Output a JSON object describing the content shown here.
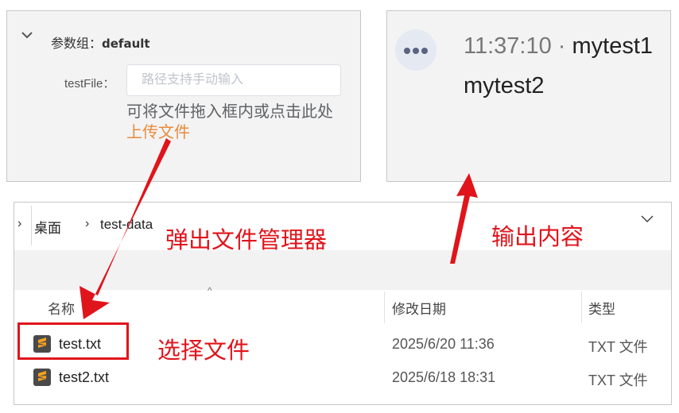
{
  "param_panel": {
    "group_label": "参数组：",
    "group_value": "default",
    "field_label": "testFile：",
    "input_placeholder": "路径支持手动输入",
    "hint_text": "可将文件拖入框内或点击此处 ",
    "upload_link": "上传文件",
    "accent_color": "#e88b3c"
  },
  "output_panel": {
    "time": "11:37:10",
    "separator": " · ",
    "line1": "mytest1",
    "line2": "mytest2"
  },
  "explorer": {
    "breadcrumb": [
      "桌面",
      "test-data"
    ],
    "columns": {
      "name": "名称",
      "modified": "修改日期",
      "type": "类型"
    },
    "files": [
      {
        "name": "test.txt",
        "modified": "2025/6/20 11:36",
        "type": "TXT 文件"
      },
      {
        "name": "test2.txt",
        "modified": "2025/6/18 18:31",
        "type": "TXT 文件"
      }
    ]
  },
  "annotations": {
    "open_file_manager": "弹出文件管理器",
    "output_content": "输出内容",
    "select_file": "选择文件",
    "color": "#e0141b"
  }
}
